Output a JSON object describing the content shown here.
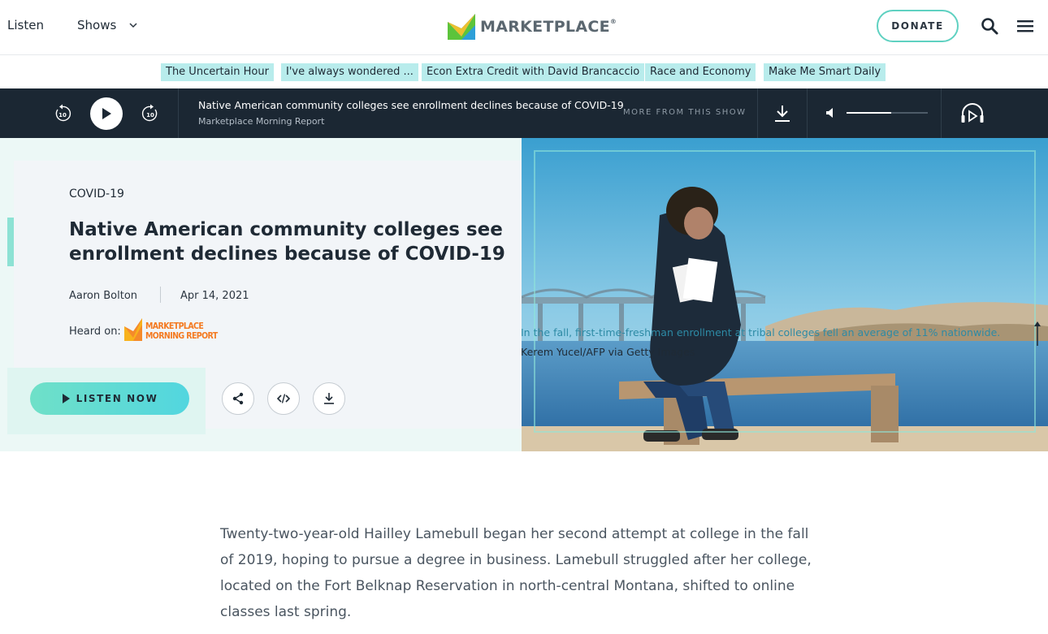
{
  "nav": {
    "listen": "Listen",
    "shows": "Shows",
    "logo_text": "MARKETPLACE",
    "logo_mark": "®",
    "donate": "DONATE"
  },
  "pills": [
    "The Uncertain Hour",
    "I've always wondered ...",
    "Econ Extra Credit with David Brancaccio",
    "Race and Economy",
    "Make Me Smart Daily"
  ],
  "player": {
    "title": "Native American community colleges see enrollment declines because of COVID-19",
    "show": "Marketplace Morning Report",
    "more": "MORE FROM THIS SHOW",
    "skip_back": "10",
    "skip_fwd": "10",
    "volume_level": 0.55
  },
  "article": {
    "kicker": "COVID-19",
    "headline": "Native American community colleges see enrollment declines because of COVID-19",
    "author": "Aaron Bolton",
    "date": "Apr 14, 2021",
    "heard_on": "Heard on:",
    "show_logo_line1": "MARKETPLACE",
    "show_logo_line2": "MORNING REPORT",
    "listen_now": "LISTEN NOW",
    "caption": "In the fall, first-time-freshman enrollment at tribal colleges fell an average of 11% nationwide.",
    "credit": "Kerem Yucel/AFP via Getty Images",
    "body": "Twenty-two-year-old Hailley Lamebull began her second attempt at college in the fall of 2019, hoping to pursue a degree in business. Lamebull struggled after her college, located on the Fort Belknap Reservation in north-central Montana, shifted to online classes last spring."
  }
}
